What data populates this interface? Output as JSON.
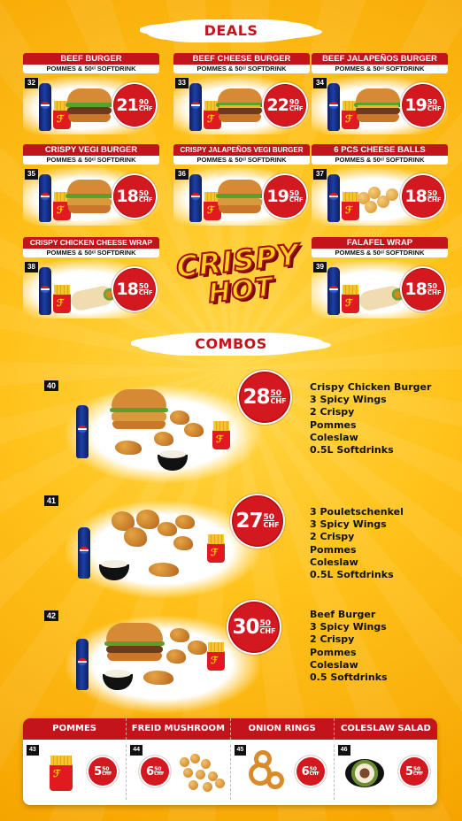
{
  "colors": {
    "accent": "#c4141b",
    "background": "#ffc21a"
  },
  "sections": {
    "deals": "DEALS",
    "combos": "COMBOS"
  },
  "deals": [
    {
      "num": "32",
      "title": "BEEF BURGER",
      "sub": "POMMES & 50ᶜˡ SOFTDRINK",
      "price_main": "21",
      "price_cents": "90",
      "currency": "CHF"
    },
    {
      "num": "33",
      "title": "BEEF CHEESE BURGER",
      "sub": "POMMES & 50ᶜˡ SOFTDRINK",
      "price_main": "22",
      "price_cents": "90",
      "currency": "CHF"
    },
    {
      "num": "34",
      "title": "BEEF JALAPEÑOS BURGER",
      "sub": "POMMES & 50ᶜˡ SOFTDRINK",
      "price_main": "19",
      "price_cents": "50",
      "currency": "CHF"
    },
    {
      "num": "35",
      "title": "CRISPY VEGI BURGER",
      "sub": "POMMES & 50ᶜˡ SOFTDRINK",
      "price_main": "18",
      "price_cents": "50",
      "currency": "CHF"
    },
    {
      "num": "36",
      "title": "CRISPY JALAPEÑOS VEGI BURGER",
      "sub": "POMMES & 50ᶜˡ SOFTDRINK",
      "price_main": "19",
      "price_cents": "50",
      "currency": "CHF"
    },
    {
      "num": "37",
      "title": "6 PCS CHEESE BALLS",
      "sub": "POMMES & 50ᶜˡ SOFTDRINK",
      "price_main": "18",
      "price_cents": "50",
      "currency": "CHF"
    },
    {
      "num": "38",
      "title": "CRISPY CHICKEN CHEESE WRAP",
      "sub": "POMMES & 50ᶜˡ SOFTDRINK",
      "price_main": "18",
      "price_cents": "50",
      "currency": "CHF"
    },
    {
      "num": "39",
      "title": "FALAFEL WRAP",
      "sub": "POMMES & 50ᶜˡ SOFTDRINK",
      "price_main": "18",
      "price_cents": "50",
      "currency": "CHF"
    }
  ],
  "logo": {
    "line1": "CRISPY",
    "line2": "HOT"
  },
  "combos": [
    {
      "num": "40",
      "price_main": "28",
      "price_cents": "50",
      "currency": "CHF",
      "items": [
        "Crispy Chicken Burger",
        "3 Spicy Wings",
        "2 Crispy",
        "Pommes",
        "Coleslaw",
        "0.5L Softdrinks"
      ]
    },
    {
      "num": "41",
      "price_main": "27",
      "price_cents": "50",
      "currency": "CHF",
      "items": [
        "3 Pouletschenkel",
        "3 Spicy Wings",
        "2 Crispy",
        "Pommes",
        "Coleslaw",
        "0.5L Softdrinks"
      ]
    },
    {
      "num": "42",
      "price_main": "30",
      "price_cents": "50",
      "currency": "CHF",
      "items": [
        "Beef Burger",
        "3 Spicy Wings",
        "2 Crispy",
        "Pommes",
        "Coleslaw",
        "0.5 Softdrinks"
      ]
    }
  ],
  "sides": [
    {
      "num": "43",
      "title": "POMMES",
      "price_main": "5",
      "price_cents": "50",
      "currency": "CHF",
      "icon": "fries-icon"
    },
    {
      "num": "44",
      "title": "FREID MUSHROOM",
      "price_main": "6",
      "price_cents": "50",
      "currency": "CHF",
      "icon": "mushroom-icon"
    },
    {
      "num": "45",
      "title": "ONION RINGS",
      "price_main": "6",
      "price_cents": "50",
      "currency": "CHF",
      "icon": "onion-rings-icon"
    },
    {
      "num": "46",
      "title": "COLESLAW SALAD",
      "price_main": "5",
      "price_cents": "50",
      "currency": "CHF",
      "icon": "salad-icon"
    }
  ]
}
